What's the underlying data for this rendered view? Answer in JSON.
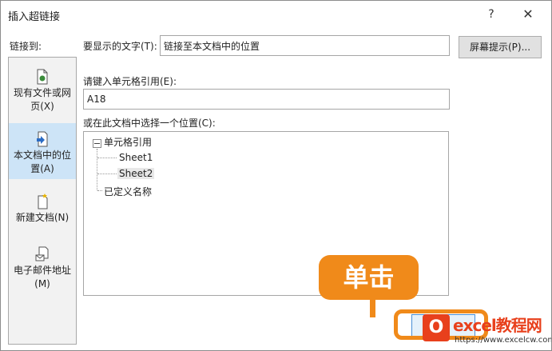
{
  "dialog": {
    "title": "插入超链接",
    "help_label": "?",
    "close_label": "✕"
  },
  "link_to_label": "链接到:",
  "nav": {
    "items": [
      {
        "label_line1": "现有文件或网",
        "label_line2": "页(X)",
        "icon": "file-web-icon",
        "active": false
      },
      {
        "label_line1": "本文档中的位",
        "label_line2": "置(A)",
        "icon": "document-location-icon",
        "active": true
      },
      {
        "label_line1": "新建文档(N)",
        "label_line2": "",
        "icon": "new-document-icon",
        "active": false
      },
      {
        "label_line1": "电子邮件地址",
        "label_line2": "(M)",
        "icon": "email-icon",
        "active": false
      }
    ]
  },
  "display_text": {
    "label": "要显示的文字(T):",
    "value": "链接至本文档中的位置"
  },
  "screentip_button": "屏幕提示(P)...",
  "cell_ref": {
    "label": "请键入单元格引用(E):",
    "value": "A18"
  },
  "place_label": "或在此文档中选择一个位置(C):",
  "tree": {
    "root": "单元格引用",
    "sheets": [
      "Sheet1",
      "Sheet2"
    ],
    "defined_names": "已定义名称"
  },
  "callout": {
    "text": "单击",
    "color": "#f08a1a"
  },
  "watermark": {
    "brand": "excel教程网",
    "url": "https://www.excelcw.com"
  },
  "colors": {
    "active_nav": "#cde4f7",
    "accent_orange": "#f08a1a",
    "watermark_red": "#e8401c"
  }
}
